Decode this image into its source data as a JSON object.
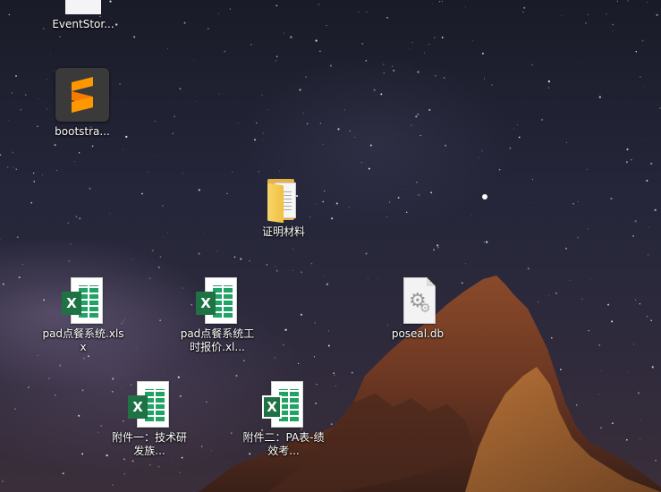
{
  "desktop": {
    "icons": [
      {
        "name": "eventstorming-file",
        "label": "EventStor..."
      },
      {
        "name": "bootstrap-sublime",
        "label": "bootstra..."
      },
      {
        "name": "folder-certificates",
        "label": "证明材料"
      },
      {
        "name": "pad-xlsx",
        "label": "pad点餐系统.xlsx"
      },
      {
        "name": "pad-hours-xlsx",
        "label": "pad点餐系统工时报价.xl..."
      },
      {
        "name": "poseal-db",
        "label": "poseal.db"
      },
      {
        "name": "attachment1-xlsx",
        "label": "附件一：技术研发族..."
      },
      {
        "name": "attachment2-xlsx",
        "label": "附件二：PA表-绩效考..."
      }
    ],
    "excel_badge": "X",
    "colors": {
      "excel_green": "#1f7244",
      "folder": "#f0c040",
      "sublime_orange": "#ff9800"
    }
  }
}
